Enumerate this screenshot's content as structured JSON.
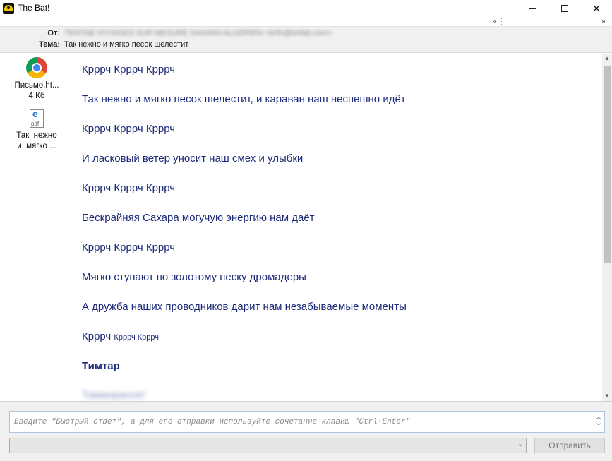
{
  "window": {
    "title": "The Bat!",
    "controls": {
      "minimize": "minimize-icon",
      "maximize": "maximize-icon",
      "close": "close-icon"
    }
  },
  "header": {
    "from_label": "От:",
    "from_value": "TENTAB VOYAGES SUR MESURE SAHARA ALGERIEN <tinfo@tinfab.com>",
    "subject_label": "Тема:",
    "subject_value": "Так нежно и мягко песок шелестит"
  },
  "attachments": [
    {
      "icon": "chrome-icon",
      "name": "Письмо.ht...",
      "size": "4 Кб"
    },
    {
      "icon": "pdf-icon",
      "name_line1": "Так  нежно",
      "name_line2": "и  мягко ..."
    }
  ],
  "body": {
    "lines": [
      "Крррч Крррч Крррч",
      "Так нежно и мягко песок шелестит, и караван наш неспешно идёт",
      "Крррч Крррч Крррч",
      "И ласковый ветер уносит наш смех и улыбки",
      "Крррч Крррч Крррч",
      "Бескрайняя Сахара могучую энергию нам даёт",
      "Крррч Крррч Крррч",
      "Мягко ступают по золотому песку дромадеры",
      "А дружба наших проводников дарит нам незабываемые моменты"
    ],
    "mixed_line": {
      "large": "Крррч",
      "small": "Крррч Крррч"
    },
    "signature": "Тимтар",
    "blurred_line": "Таманрассет"
  },
  "quick_reply": {
    "placeholder": "Введите \"Быстрый ответ\", а для его отправки используйте сочетание клавиш \"Ctrl+Enter\""
  },
  "send_button": "Отправить",
  "colors": {
    "body_text": "#1c2a7a",
    "header_bg": "#f0f0f0",
    "panel_border": "#b9cbe0"
  }
}
